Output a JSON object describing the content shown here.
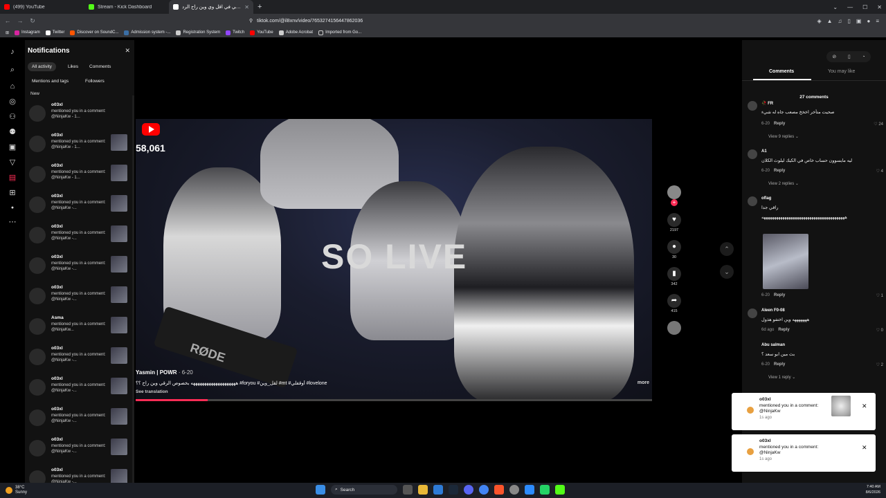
{
  "browser": {
    "tabs": [
      {
        "label": "(499) YouTube",
        "color": "#ff0000"
      },
      {
        "label": "Stream - Kick Dashboard",
        "color": "#53fc18"
      },
      {
        "label": "أوقفلي في اقل وي وين راح الرد",
        "color": "#ffffff"
      }
    ],
    "url": "tiktok.com/@il8xnv/video/7653274156447862036",
    "bookmarks": [
      {
        "label": "Instagram",
        "color": "#d6249f"
      },
      {
        "label": "Twitter",
        "color": "#ffffff"
      },
      {
        "label": "Discover on SoundC...",
        "color": "#ff5500"
      },
      {
        "label": "Admission system -...",
        "color": "#3a6ea5"
      },
      {
        "label": "Registration System",
        "color": "#cccccc"
      },
      {
        "label": "Twitch",
        "color": "#9146ff"
      },
      {
        "label": "YouTube",
        "color": "#ff0000"
      },
      {
        "label": "Adobe Acrobat",
        "color": "#cccccc"
      },
      {
        "label": "Imported from Go...",
        "color": "#cccccc"
      }
    ]
  },
  "notifications": {
    "title": "Notifications",
    "filters": [
      "All activity",
      "Likes",
      "Comments",
      "Mentions and tags",
      "Followers"
    ],
    "section": "New",
    "items": [
      {
        "name": "o03xl",
        "text": "mentioned you in a comment: @NinjaKw - 1..."
      },
      {
        "name": "o03xl",
        "text": "mentioned you in a comment: @NinjaKw - 1..."
      },
      {
        "name": "o03xl",
        "text": "mentioned you in a comment: @NinjaKw - 1..."
      },
      {
        "name": "o03xl",
        "text": "mentioned you in a comment: @NinjaKw -..."
      },
      {
        "name": "o03xl",
        "text": "mentioned you in a comment: @NinjaKw -..."
      },
      {
        "name": "o03xl",
        "text": "mentioned you in a comment: @NinjaKw -..."
      },
      {
        "name": "o03xl",
        "text": "mentioned you in a comment: @NinjaKw -..."
      },
      {
        "name": "Asma",
        "text": "mentioned you in a comment: @NinjaKw..."
      },
      {
        "name": "o03xl",
        "text": "mentioned you in a comment: @NinjaKw -..."
      },
      {
        "name": "o03xl",
        "text": "mentioned you in a comment: @NinjaKw -..."
      },
      {
        "name": "o03xl",
        "text": "mentioned you in a comment: @NinjaKw -..."
      },
      {
        "name": "o03xl",
        "text": "mentioned you in a comment: @NinjaKw -..."
      },
      {
        "name": "o03xl",
        "text": "mentioned you in a comment: @NinjaKw -..."
      }
    ]
  },
  "video": {
    "overlay_text": "SO LIVE",
    "yt_count": "58,061",
    "mic_brand": "RØDE",
    "author": "Yasmin | POWR",
    "date": "· 6-20",
    "caption": "ههههههههههههههههههههه بخصوص الرقي وين راح ؟؟ #foryou #لقل_وين #mt #أوقفلي #lovelone",
    "see_translation": "See translation",
    "more": "more",
    "progress": 0.14
  },
  "actions": {
    "likes": "2197",
    "comments": "30",
    "saves": "342",
    "shares": "415"
  },
  "comments_panel": {
    "tabs": [
      "Comments",
      "You may like"
    ],
    "count_label": "27 comments",
    "comments": [
      {
        "name": "🥀 FR",
        "text": "صحيت متأخر اخخخ مصعب جاه له شيء",
        "meta": "6-20",
        "reply": "Reply",
        "likes": "24",
        "replies": "View 9 replies"
      },
      {
        "name": "A1",
        "text": "ليه مايسوون حساب خاص في الكيك ليلوث الكلان",
        "meta": "6-20",
        "reply": "Reply",
        "likes": "4",
        "replies": "View 2 replies"
      },
      {
        "name": "oflag",
        "text": "راقي جدا",
        "text2": "ههههههههههههههههههههههههههههههههههههههههه",
        "meta": "6-20",
        "reply": "Reply",
        "likes": "1"
      },
      {
        "name": "Aleen F0-08",
        "text": "هههههههه وين اختفو هذول",
        "meta": "6d ago",
        "reply": "Reply",
        "likes": "0"
      },
      {
        "name": "Abu salman",
        "text": "بث مين ابو سعد ؟",
        "meta": "6-20",
        "reply": "Reply",
        "likes": "2",
        "replies": "View 1 reply"
      }
    ]
  },
  "toasts": [
    {
      "name": "o03xl",
      "text": "mentioned you in a comment: @NinjaKw",
      "time": "1s ago"
    },
    {
      "name": "o03xl",
      "text": "mentioned you in a comment: @NinjaKw",
      "time": "1s ago"
    }
  ],
  "taskbar": {
    "temp": "38°C",
    "condition": "Sunny",
    "search": "Search",
    "time": "7:40 AM",
    "date": "8/6/2026"
  }
}
